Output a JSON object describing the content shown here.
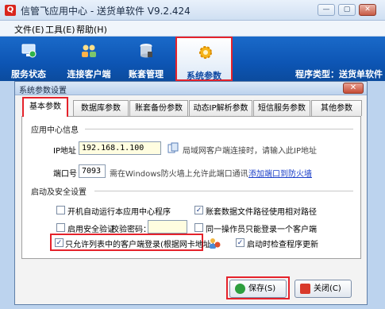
{
  "window": {
    "title": "信管飞应用中心 - 送货单软件 V9.2.424",
    "controls": [
      "—",
      "▢",
      "✕"
    ]
  },
  "menu": [
    "文件(E)",
    "工具(E)",
    "帮助(H)"
  ],
  "ribbon": {
    "tabs": [
      "服务状态",
      "连接客户端",
      "账套管理",
      "系统参数"
    ],
    "program_type": "程序类型：送货单软件"
  },
  "dialog": {
    "title": "系统参数设置",
    "close": "✕",
    "tabs": [
      "基本参数",
      "数据库参数",
      "账套备份参数",
      "动态IP解析参数",
      "短信服务参数",
      "其他参数"
    ],
    "app_center": {
      "heading": "应用中心信息",
      "ip_label": "IP地址",
      "ip_value": "192.168.1.100",
      "ip_hint": "局域网客户端连接时，请输入此IP地址",
      "port_label": "端口号",
      "port_value": "7093",
      "port_hint": "需在Windows防火墙上允许此端口通讯",
      "firewall_link": "添加端口到防火墙"
    },
    "startup": {
      "heading": "启动及安全设置",
      "auto_start": "开机自动运行本应用中心程序",
      "relative_path": "账套数据文件路径使用相对路径",
      "security": "启用安全验证",
      "password_label": "校验密码：",
      "single_client": "同一操作员只能登录一个客户端",
      "whitelist": "只允许列表中的客户端登录(根据网卡地址)",
      "auto_update": "启动时检查程序更新",
      "check": "✓"
    },
    "buttons": {
      "save": "保存(S)",
      "close": "关闭(C)"
    }
  },
  "colors": {
    "ribbon": "#0d55b4",
    "highlight": "#e5222b",
    "link": "#1b3fc8"
  }
}
